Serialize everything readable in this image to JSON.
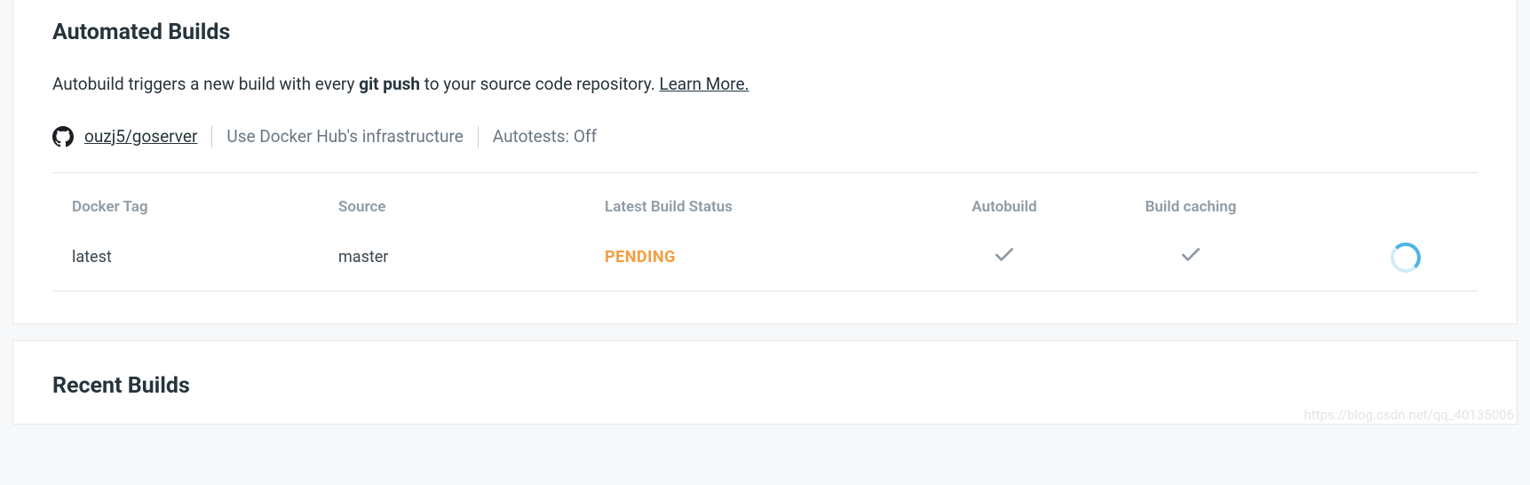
{
  "automated_builds": {
    "title": "Automated Builds",
    "description_prefix": "Autobuild triggers a new build with every ",
    "description_bold": "git push",
    "description_suffix": " to your source code repository. ",
    "learn_more_label": "Learn More.",
    "repo_link": "ouzj5/goserver",
    "infra_text": "Use Docker Hub's infrastructure",
    "autotests_text": "Autotests: Off",
    "columns": {
      "docker_tag": "Docker Tag",
      "source": "Source",
      "latest_build_status": "Latest Build Status",
      "autobuild": "Autobuild",
      "build_caching": "Build caching"
    },
    "row": {
      "docker_tag": "latest",
      "source": "master",
      "status": "PENDING",
      "autobuild_enabled": true,
      "build_caching_enabled": true
    }
  },
  "recent_builds": {
    "title": "Recent Builds"
  },
  "watermark": "https://blog.csdn.net/qq_40135006"
}
